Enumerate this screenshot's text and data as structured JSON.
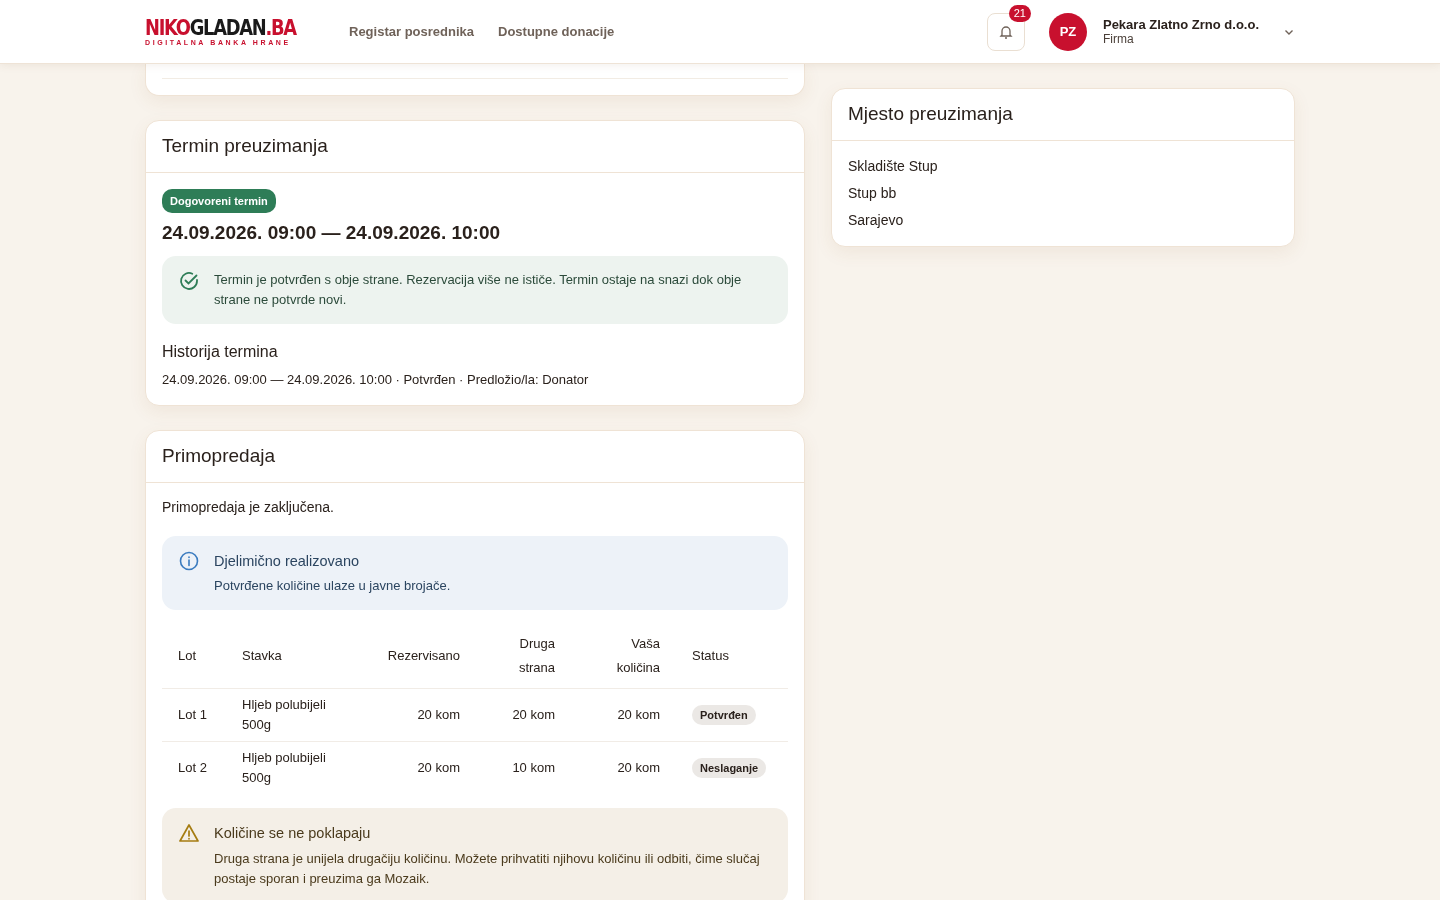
{
  "header": {
    "logo": {
      "part1": "NIKO",
      "part2": "GLADAN",
      "part3": ".BA",
      "tagline": "DIGITALNA BANKA HRANE"
    },
    "nav": [
      {
        "label": "Registar posrednika"
      },
      {
        "label": "Dostupne donacije"
      }
    ],
    "notifications": {
      "count": "21"
    },
    "user": {
      "initials": "PZ",
      "name": "Pekara Zlatno Zrno d.o.o.",
      "role": "Firma"
    }
  },
  "termin": {
    "title": "Termin preuzimanja",
    "badge": "Dogovoreni termin",
    "range": "24.09.2026. 09:00 — 24.09.2026. 10:00",
    "alert": {
      "kind": "success",
      "text": "Termin je potvrđen s obje strane. Rezervacija više ne ističe. Termin ostaje na snazi dok obje strane ne potvrde novi."
    },
    "history_title": "Historija termina",
    "history": [
      "24.09.2026. 09:00 — 24.09.2026. 10:00 · Potvrđen · Predložio/la: Donator"
    ]
  },
  "primopredaja": {
    "title": "Primopredaja",
    "status_text": "Primopredaja je zaključena.",
    "info": {
      "kind": "info",
      "title": "Djelimično realizovano",
      "text": "Potvrđene količine ulaze u javne brojače."
    },
    "table": {
      "columns": [
        {
          "label": "Lot"
        },
        {
          "label": "Stavka"
        },
        {
          "label": "Rezervisano"
        },
        {
          "label": "Druga strana"
        },
        {
          "label": "Vaša količina"
        },
        {
          "label": "Status"
        }
      ],
      "rows": [
        {
          "cells": [
            "Lot 1",
            "Hljeb polubijeli 500g",
            "20 kom",
            "20 kom",
            "20 kom"
          ],
          "status": "Potvrđen"
        },
        {
          "cells": [
            "Lot 2",
            "Hljeb polubijeli 500g",
            "20 kom",
            "10 kom",
            "20 kom"
          ],
          "status": "Neslaganje"
        }
      ]
    },
    "warning": {
      "kind": "warning",
      "title": "Količine se ne poklapaju",
      "text": "Druga strana je unijela drugačiju količinu. Možete prihvatiti njihovu količinu ili odbiti, čime slučaj postaje sporan i preuzima ga Mozaik."
    }
  },
  "mjesto": {
    "title": "Mjesto preuzimanja",
    "lines": [
      "Skladište Stup",
      "Stup bb",
      "Sarajevo"
    ]
  }
}
